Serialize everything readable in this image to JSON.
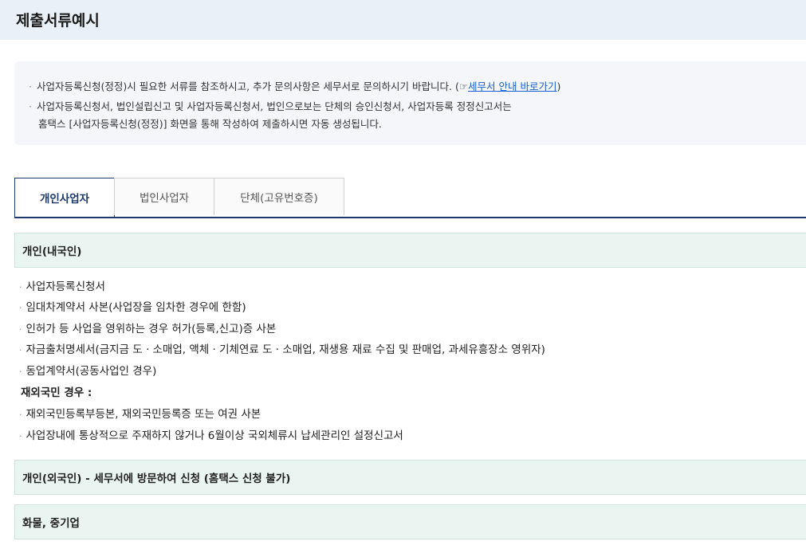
{
  "page": {
    "title": "제출서류예시"
  },
  "notice": {
    "line1_text": "사업자등록신청(정정)시 필요한 서류를 참조하시고, 추가 문의사항은 세무서로 문의하시기 바랍니다. (",
    "line1_link_prefix": "☞",
    "line1_link": "세무서 안내 바로가기",
    "line1_close": ")",
    "line2": "사업자등록신청서, 법인설립신고 및 사업자등록신청서, 법인으로보는 단체의 승인신청서, 사업자등록 정정신고서는",
    "line3": "홈택스 [사업자등록신청(정정)] 화면을 통해 작성하여 제출하시면 자동 생성됩니다."
  },
  "tabs": [
    {
      "label": "개인사업자",
      "active": true
    },
    {
      "label": "법인사업자",
      "active": false
    },
    {
      "label": "단체(고유번호증)",
      "active": false
    }
  ],
  "sections": {
    "domestic": {
      "title": "개인(내국인)",
      "items": [
        "사업자등록신청서",
        "임대차계약서 사본(사업장을 임차한 경우에 한함)",
        "인허가 등 사업을 영위하는 경우 허가(등록,신고)증 사본",
        "자금출처명세서(금지금 도 · 소매업, 액체 · 기체연료 도 · 소매업, 재생용 재료 수집 및 판매업, 과세유흥장소 영위자)",
        "동업계약서(공동사업인 경우)"
      ],
      "overseas_heading": "재외국민 경우 :",
      "overseas_items": [
        "재외국민등록부등본, 재외국민등록증 또는 여권 사본",
        "사업장내에 통상적으로 주재하지 않거나 6월이상 국외체류시 납세관리인 설정신고서"
      ]
    },
    "foreigner": {
      "title": "개인(외국인) - 세무서에 방문하여 신청 (홈택스 신청 불가)"
    },
    "cargo": {
      "title": "화물, 중기업"
    }
  },
  "colors": {
    "header_bg": "#eaf0f7",
    "notice_bg": "#f4f6f9",
    "tab_active": "#1e3a6e",
    "section_bg": "#eaf5f1",
    "link": "#1a5fd0"
  }
}
